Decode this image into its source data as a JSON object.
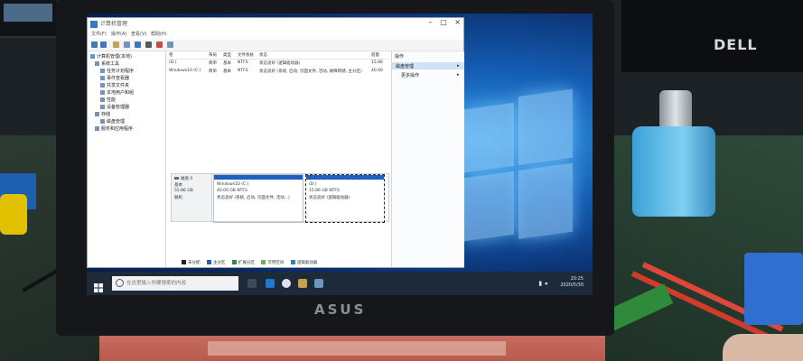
{
  "scene": {
    "desk_monitor_brand": "DELL",
    "laptop_brand": "ASUS"
  },
  "window": {
    "title": "计算机管理",
    "menu": [
      "文件(F)",
      "操作(A)",
      "查看(V)",
      "帮助(H)"
    ],
    "tree": [
      "计算机管理(本地)",
      "系统工具",
      "任务计划程序",
      "事件查看器",
      "共享文件夹",
      "本地用户和组",
      "性能",
      "设备管理器",
      "存储",
      "磁盘管理",
      "服务和应用程序"
    ],
    "columns": [
      "卷",
      "布局",
      "类型",
      "文件系统",
      "状态",
      "容量",
      "可用空间"
    ],
    "volumes": [
      {
        "name": "(D:)",
        "layout": "简单",
        "type": "基本",
        "fs": "NTFS",
        "status": "状态良好 (逻辑驱动器)",
        "size": "15.86"
      },
      {
        "name": "Windows10 (C:)",
        "layout": "简单",
        "type": "基本",
        "fs": "NTFS",
        "status": "状态良好 (系统, 启动, 页面文件, 活动, 故障转储, 主分区)",
        "size": "40.00"
      }
    ],
    "actions_header": "操作",
    "actions": [
      "磁盘管理",
      "更多操作"
    ],
    "disk": {
      "label": "磁盘 0",
      "type": "基本",
      "size": "55.86 GB",
      "status": "联机",
      "partitions": [
        {
          "name": "Windows10 (C:)",
          "size": "40.00 GB NTFS",
          "status": "状态良好 (系统, 启动, 页面文件, 活动...)"
        },
        {
          "name": "(D:)",
          "size": "15.86 GB NTFS",
          "status": "状态良好 (逻辑驱动器)"
        }
      ]
    },
    "legend": [
      "未分配",
      "主分区",
      "扩展分区",
      "可用空间",
      "逻辑驱动器"
    ]
  },
  "taskbar": {
    "search_placeholder": "在这里输入你要搜索的内容",
    "time": "20:25",
    "date": "2020/5/30"
  },
  "colors": {
    "accent": "#1e5fc0",
    "taskbar": "#1d2a3a"
  }
}
